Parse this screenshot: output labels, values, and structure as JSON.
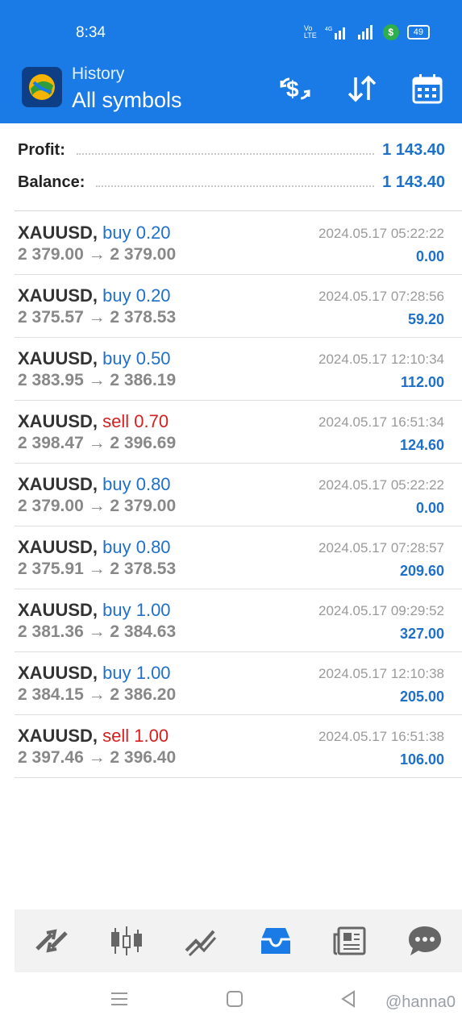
{
  "status": {
    "time": "8:34",
    "battery": "49"
  },
  "header": {
    "subtitle": "History",
    "title": "All symbols"
  },
  "summary": {
    "profit_label": "Profit:",
    "profit_value": "1 143.40",
    "balance_label": "Balance:",
    "balance_value": "1 143.40"
  },
  "trades": [
    {
      "symbol": "XAUUSD,",
      "dir": "buy",
      "lot": "buy 0.20",
      "prices": "2 379.00 → 2 379.00",
      "time": "2024.05.17 05:22:22",
      "profit": "0.00"
    },
    {
      "symbol": "XAUUSD,",
      "dir": "buy",
      "lot": "buy 0.20",
      "prices": "2 375.57 → 2 378.53",
      "time": "2024.05.17 07:28:56",
      "profit": "59.20"
    },
    {
      "symbol": "XAUUSD,",
      "dir": "buy",
      "lot": "buy 0.50",
      "prices": "2 383.95 → 2 386.19",
      "time": "2024.05.17 12:10:34",
      "profit": "112.00"
    },
    {
      "symbol": "XAUUSD,",
      "dir": "sell",
      "lot": "sell 0.70",
      "prices": "2 398.47 → 2 396.69",
      "time": "2024.05.17 16:51:34",
      "profit": "124.60"
    },
    {
      "symbol": "XAUUSD,",
      "dir": "buy",
      "lot": "buy 0.80",
      "prices": "2 379.00 → 2 379.00",
      "time": "2024.05.17 05:22:22",
      "profit": "0.00"
    },
    {
      "symbol": "XAUUSD,",
      "dir": "buy",
      "lot": "buy 0.80",
      "prices": "2 375.91 → 2 378.53",
      "time": "2024.05.17 07:28:57",
      "profit": "209.60"
    },
    {
      "symbol": "XAUUSD,",
      "dir": "buy",
      "lot": "buy 1.00",
      "prices": "2 381.36 → 2 384.63",
      "time": "2024.05.17 09:29:52",
      "profit": "327.00"
    },
    {
      "symbol": "XAUUSD,",
      "dir": "buy",
      "lot": "buy 1.00",
      "prices": "2 384.15 → 2 386.20",
      "time": "2024.05.17 12:10:38",
      "profit": "205.00"
    },
    {
      "symbol": "XAUUSD,",
      "dir": "sell",
      "lot": "sell 1.00",
      "prices": "2 397.46 → 2 396.40",
      "time": "2024.05.17 16:51:38",
      "profit": "106.00"
    }
  ],
  "nav": {
    "items": [
      "trade-icon",
      "candles-icon",
      "chart-icon",
      "history-icon",
      "news-icon",
      "chat-icon"
    ],
    "active": "history-icon"
  },
  "watermark": "@hanna0",
  "colors": {
    "accent": "#1a7be6",
    "buy": "#1f70c8",
    "sell": "#d42020"
  }
}
